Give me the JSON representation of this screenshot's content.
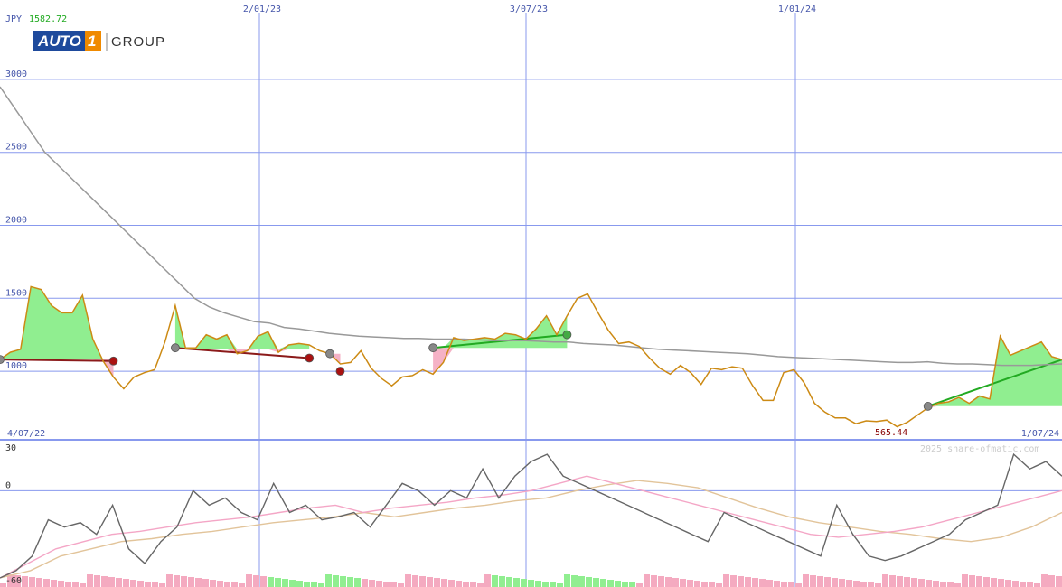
{
  "header": {
    "currency": "JPY",
    "last_price": "1582.72",
    "brand_main": "AUTO",
    "brand_num": "1",
    "brand_suffix": "GROUP",
    "watermark": "2025 share-ofmatic.com",
    "min_label": "565.44"
  },
  "colors": {
    "price": "#cc8a14",
    "ma": "#999999",
    "grid": "#8899ee",
    "green_fill": "#90ee90",
    "pink_fill": "#f4aac0",
    "brand_blue": "#1e4a9c",
    "brand_orange": "#f08a00"
  },
  "chart_data": [
    {
      "type": "line",
      "panel": "price",
      "x_labels": [
        "4/07/22",
        "2/01/23",
        "3/07/23",
        "1/01/24",
        "1/07/24"
      ],
      "y_ticks": [
        1000,
        1500,
        2000,
        2500,
        3000
      ],
      "ylim": [
        530,
        3080
      ],
      "grid": true,
      "series": [
        {
          "role": "price",
          "values": [
            1080,
            1130,
            1150,
            1580,
            1560,
            1450,
            1400,
            1400,
            1520,
            1220,
            1070,
            960,
            880,
            960,
            990,
            1010,
            1200,
            1450,
            1160,
            1160,
            1250,
            1220,
            1250,
            1120,
            1140,
            1240,
            1270,
            1130,
            1180,
            1190,
            1180,
            1140,
            1120,
            1050,
            1060,
            1140,
            1020,
            950,
            900,
            960,
            970,
            1010,
            980,
            1060,
            1230,
            1210,
            1220,
            1230,
            1220,
            1260,
            1250,
            1220,
            1290,
            1380,
            1250,
            1380,
            1500,
            1530,
            1400,
            1280,
            1190,
            1200,
            1170,
            1090,
            1020,
            980,
            1040,
            990,
            910,
            1020,
            1010,
            1030,
            1020,
            900,
            800,
            800,
            990,
            1010,
            920,
            780,
            720,
            680,
            680,
            640,
            660,
            655,
            665,
            620,
            650,
            700,
            750,
            780,
            790,
            820,
            780,
            830,
            810,
            1240,
            1110,
            1140,
            1170,
            1200,
            1100,
            1080
          ],
          "markers": [
            {
              "i": 0,
              "v": 1080,
              "kind": "start"
            },
            {
              "i": 11,
              "v": 1070,
              "kind": "sell"
            },
            {
              "i": 17,
              "v": 1160,
              "kind": "start"
            },
            {
              "i": 30,
              "v": 1090,
              "kind": "sell"
            },
            {
              "i": 32,
              "v": 1120,
              "kind": "start"
            },
            {
              "i": 33,
              "v": 1000,
              "kind": "sell"
            },
            {
              "i": 42,
              "v": 1160,
              "kind": "start"
            },
            {
              "i": 55,
              "v": 1250,
              "kind": "buy"
            },
            {
              "i": 90,
              "v": 760,
              "kind": "start"
            }
          ]
        },
        {
          "role": "moving-average",
          "values": [
            2950,
            2800,
            2650,
            2500,
            2400,
            2300,
            2200,
            2100,
            2000,
            1900,
            1800,
            1700,
            1600,
            1500,
            1440,
            1400,
            1370,
            1340,
            1330,
            1300,
            1290,
            1275,
            1260,
            1250,
            1240,
            1235,
            1230,
            1225,
            1225,
            1220,
            1220,
            1220,
            1215,
            1210,
            1210,
            1210,
            1205,
            1200,
            1200,
            1190,
            1185,
            1180,
            1170,
            1160,
            1150,
            1145,
            1140,
            1135,
            1130,
            1125,
            1120,
            1110,
            1100,
            1095,
            1090,
            1085,
            1080,
            1075,
            1070,
            1065,
            1060,
            1060,
            1065,
            1055,
            1050,
            1050,
            1045,
            1040,
            1040,
            1040,
            1045,
            1050
          ]
        }
      ]
    },
    {
      "type": "line",
      "panel": "oscillator",
      "y_ticks": [
        30,
        0,
        -60
      ],
      "ylim": [
        -60,
        30
      ],
      "series": [
        {
          "role": "oscillator",
          "values": [
            -60,
            -55,
            -45,
            -20,
            -25,
            -22,
            -30,
            -10,
            -40,
            -50,
            -35,
            -25,
            0,
            -10,
            -5,
            -15,
            -20,
            5,
            -15,
            -10,
            -20,
            -18,
            -15,
            -25,
            -10,
            5,
            0,
            -10,
            0,
            -5,
            15,
            -5,
            10,
            20,
            25,
            10,
            5,
            0,
            -5,
            -10,
            -15,
            -20,
            -25,
            -30,
            -35,
            -15,
            -20,
            -25,
            -30,
            -35,
            -40,
            -45,
            -10,
            -30,
            -45,
            -48,
            -45,
            -40,
            -35,
            -30,
            -20,
            -15,
            -10,
            25,
            15,
            20,
            10
          ]
        },
        {
          "role": "signal-pink",
          "values": [
            -60,
            -50,
            -40,
            -35,
            -30,
            -28,
            -25,
            -22,
            -20,
            -18,
            -15,
            -12,
            -10,
            -15,
            -12,
            -10,
            -8,
            -5,
            -3,
            0,
            5,
            10,
            5,
            0,
            -5,
            -10,
            -15,
            -20,
            -25,
            -30,
            -32,
            -30,
            -28,
            -25,
            -20,
            -15,
            -10,
            -5,
            0
          ]
        },
        {
          "role": "signal-tan",
          "values": [
            -60,
            -55,
            -45,
            -40,
            -35,
            -33,
            -30,
            -28,
            -25,
            -22,
            -20,
            -18,
            -15,
            -18,
            -15,
            -12,
            -10,
            -7,
            -5,
            0,
            4,
            7,
            5,
            2,
            -5,
            -12,
            -18,
            -22,
            -25,
            -28,
            -30,
            -33,
            -35,
            -32,
            -25,
            -15
          ]
        }
      ],
      "volume_bars": "pink and green volume histogram along bottom"
    }
  ]
}
